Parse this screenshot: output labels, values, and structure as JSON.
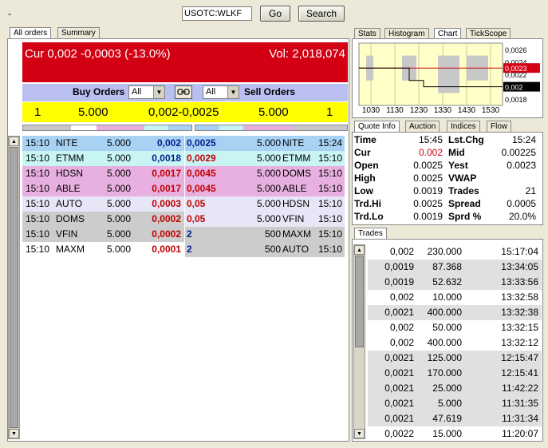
{
  "top": {
    "dash": "-",
    "symbol_value": "USOTC:WLKF",
    "go_label": "Go",
    "search_label": "Search"
  },
  "left_tabs": [
    "All orders",
    "Summary"
  ],
  "header": {
    "cur_text": "Cur 0,002 -0,0003 (-13.0%)",
    "vol_text": "Vol: 2,018,074",
    "color": "#d20012"
  },
  "orders_bar": {
    "buy_label": "Buy Orders",
    "buy_filter": "All",
    "sell_filter": "All",
    "sell_label": "Sell Orders"
  },
  "best": {
    "bid_count": "1",
    "bid_size": "5.000",
    "prices": "0,002-0,0025",
    "ask_size": "5.000",
    "ask_count": "1"
  },
  "buy_orders": [
    {
      "time": "15:10",
      "mm": "NITE",
      "size": "5.000",
      "price": "0,002",
      "bg": "#a8d2f4",
      "pc": "blue"
    },
    {
      "time": "15:10",
      "mm": "ETMM",
      "size": "5.000",
      "price": "0,0018",
      "bg": "#c8f4f4",
      "pc": "blue"
    },
    {
      "time": "15:10",
      "mm": "HDSN",
      "size": "5.000",
      "price": "0,0017",
      "bg": "#e8b0e0",
      "pc": "red"
    },
    {
      "time": "15:10",
      "mm": "ABLE",
      "size": "5.000",
      "price": "0,0017",
      "bg": "#e8b0e0",
      "pc": "red"
    },
    {
      "time": "15:10",
      "mm": "AUTO",
      "size": "5.000",
      "price": "0,0003",
      "bg": "#e6e6f6",
      "pc": "red"
    },
    {
      "time": "15:10",
      "mm": "DOMS",
      "size": "5.000",
      "price": "0,0002",
      "bg": "#cccccc",
      "pc": "red"
    },
    {
      "time": "15:10",
      "mm": "VFIN",
      "size": "5.000",
      "price": "0,0002",
      "bg": "#cccccc",
      "pc": "red"
    },
    {
      "time": "15:10",
      "mm": "MAXM",
      "size": "5.000",
      "price": "0,0001",
      "bg": "#ffffff",
      "pc": "red"
    }
  ],
  "sell_orders": [
    {
      "price": "0,0025",
      "size": "5.000",
      "mm": "NITE",
      "time": "15:24",
      "bg": "#a8d2f4",
      "pc": "blue"
    },
    {
      "price": "0,0029",
      "size": "5.000",
      "mm": "ETMM",
      "time": "15:10",
      "bg": "#c8f4f4",
      "pc": "red"
    },
    {
      "price": "0,0045",
      "size": "5.000",
      "mm": "DOMS",
      "time": "15:10",
      "bg": "#e8b0e0",
      "pc": "red"
    },
    {
      "price": "0,0045",
      "size": "5.000",
      "mm": "ABLE",
      "time": "15:10",
      "bg": "#e8b0e0",
      "pc": "red"
    },
    {
      "price": "0,05",
      "size": "5.000",
      "mm": "HDSN",
      "time": "15:10",
      "bg": "#e6e6f6",
      "pc": "red"
    },
    {
      "price": "0,05",
      "size": "5.000",
      "mm": "VFIN",
      "time": "15:10",
      "bg": "#e6e6f6",
      "pc": "red"
    },
    {
      "price": "2",
      "size": "500",
      "mm": "MAXM",
      "time": "15:10",
      "bg": "#cccccc",
      "pc": "blue"
    },
    {
      "price": "2",
      "size": "500",
      "mm": "AUTO",
      "time": "15:10",
      "bg": "#cccccc",
      "pc": "blue"
    }
  ],
  "right_tabs_top": [
    "Stats",
    "Histogram",
    "Chart",
    "TickScope"
  ],
  "chart_data": {
    "type": "line",
    "x_ticks": [
      "1030",
      "1130",
      "1230",
      "1330",
      "1430",
      "1530"
    ],
    "y_ticks": [
      "0,0026",
      "0,0024",
      "0,0023",
      "0,0022",
      "0,002",
      "0,0018"
    ],
    "ref_line": "0,0023",
    "cur_value": "0,002",
    "ylim": [
      0.0017,
      0.0027
    ],
    "price_path": [
      [
        0,
        0.0023
      ],
      [
        0.35,
        0.0023
      ],
      [
        0.35,
        0.0021
      ],
      [
        0.45,
        0.0021
      ],
      [
        0.45,
        0.002
      ],
      [
        1,
        0.002
      ]
    ],
    "ranges": [
      {
        "x0": 0.05,
        "x1": 0.1,
        "low": 0.0021,
        "high": 0.0025
      },
      {
        "x0": 0.3,
        "x1": 0.4,
        "low": 0.0021,
        "high": 0.0025
      },
      {
        "x0": 0.55,
        "x1": 0.7,
        "low": 0.0019,
        "high": 0.0025
      },
      {
        "x0": 0.75,
        "x1": 0.9,
        "low": 0.0021,
        "high": 0.0025
      }
    ]
  },
  "quote_tabs": [
    "Quote Info",
    "Auction",
    "Indices",
    "Flow"
  ],
  "quote": [
    {
      "l1": "Time",
      "v1": "15:45",
      "l2": "Lst.Chg",
      "v2": "15:24",
      "red": false
    },
    {
      "l1": "Cur",
      "v1": "0.002",
      "l2": "Mid",
      "v2": "0.00225",
      "red": true
    },
    {
      "l1": "Open",
      "v1": "0.0025",
      "l2": "Yest",
      "v2": "0.0023",
      "red": false
    },
    {
      "l1": "High",
      "v1": "0.0025",
      "l2": "VWAP",
      "v2": "",
      "red": false
    },
    {
      "l1": "Low",
      "v1": "0.0019",
      "l2": "Trades",
      "v2": "21",
      "red": false
    },
    {
      "l1": "Trd.Hi",
      "v1": "0.0025",
      "l2": "Spread",
      "v2": "0.0005",
      "red": false
    },
    {
      "l1": "Trd.Lo",
      "v1": "0.0019",
      "l2": "Sprd %",
      "v2": "20.0%",
      "red": false
    }
  ],
  "trades_tab": "Trades",
  "trades": [
    {
      "price": "0,002",
      "size": "230.000",
      "time": "15:17:04"
    },
    {
      "price": "0,0019",
      "size": "87.368",
      "time": "13:34:05"
    },
    {
      "price": "0,0019",
      "size": "52.632",
      "time": "13:33:56"
    },
    {
      "price": "0,002",
      "size": "10.000",
      "time": "13:32:58"
    },
    {
      "price": "0,0021",
      "size": "400.000",
      "time": "13:32:38"
    },
    {
      "price": "0,002",
      "size": "50.000",
      "time": "13:32:15"
    },
    {
      "price": "0,002",
      "size": "400.000",
      "time": "13:32:12"
    },
    {
      "price": "0,0021",
      "size": "125.000",
      "time": "12:15:47"
    },
    {
      "price": "0,0021",
      "size": "170.000",
      "time": "12:15:41"
    },
    {
      "price": "0,0021",
      "size": "25.000",
      "time": "11:42:22"
    },
    {
      "price": "0,0021",
      "size": "5.000",
      "time": "11:31:35"
    },
    {
      "price": "0,0021",
      "size": "47.619",
      "time": "11:31:34"
    },
    {
      "price": "0,0022",
      "size": "15.000",
      "time": "11:20:07"
    }
  ],
  "colors": {
    "accent_red": "#d20012",
    "bar_blue": "#b9bff0",
    "best_yellow": "#ffff00",
    "price_blue": "#00208a",
    "price_red": "#c00000"
  }
}
